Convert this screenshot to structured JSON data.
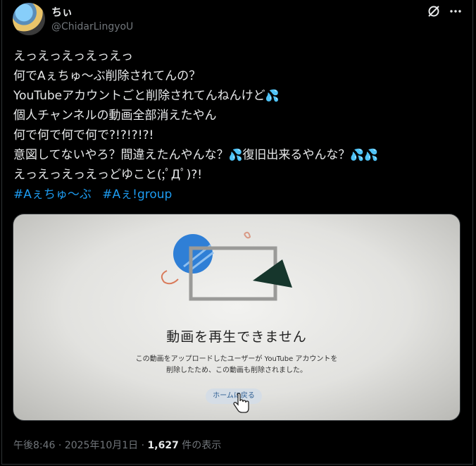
{
  "author": {
    "display_name": "ちぃ",
    "handle": "@ChidarLingyoU"
  },
  "icons": {
    "grok": "grok-icon",
    "more": "more-icon",
    "sweat_drops": "sweat-drops-emoji",
    "cursor": "hand-cursor"
  },
  "tweet": {
    "lines": [
      "えっえっえっえっえっ",
      "何でAぇちゅ〜ぶ削除されてんの？",
      "YouTubeアカウントごと削除されてんねんけど",
      "個人チャンネルの動画全部消えたやん",
      "何で何で何で何で?!?!?!?!",
      "意図してないやろ？間違えたんやんな？",
      "復旧出来るやんな？",
      "えっえっえっえっどゆこと(;ﾟДﾟ)?!"
    ],
    "hashtags": [
      "#Aぇちゅ〜ぶ",
      "#Aぇ!group"
    ]
  },
  "media": {
    "title": "動画を再生できません",
    "message_line1": "この動画をアップロードしたユーザーが YouTube アカウントを",
    "message_line2": "削除したため、この動画も削除されました。",
    "button_label": "ホームに戻る"
  },
  "meta": {
    "time": "午後8:46",
    "date": "2025年10月1日",
    "separator": " · ",
    "views_count": "1,627",
    "views_label": " 件の表示"
  },
  "colors": {
    "background": "#000000",
    "text": "#e7e9ea",
    "muted": "#71767b",
    "accent": "#1d9bf0"
  }
}
